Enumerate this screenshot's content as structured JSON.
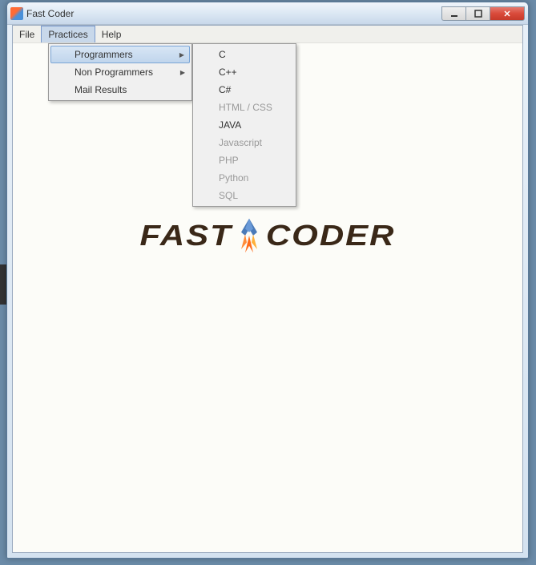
{
  "window": {
    "title": "Fast Coder"
  },
  "menubar": {
    "items": [
      {
        "label": "File"
      },
      {
        "label": "Practices"
      },
      {
        "label": "Help"
      }
    ]
  },
  "dropdown_practices": {
    "items": [
      {
        "label": "Programmers",
        "has_submenu": true,
        "highlighted": true
      },
      {
        "label": "Non Programmers",
        "has_submenu": true
      },
      {
        "label": "Mail Results",
        "has_submenu": false
      }
    ]
  },
  "dropdown_programmers": {
    "items": [
      {
        "label": "C",
        "enabled": true
      },
      {
        "label": "C++",
        "enabled": true
      },
      {
        "label": "C#",
        "enabled": true
      },
      {
        "label": "HTML / CSS",
        "enabled": false
      },
      {
        "label": "JAVA",
        "enabled": true
      },
      {
        "label": "Javascript",
        "enabled": false
      },
      {
        "label": "PHP",
        "enabled": false
      },
      {
        "label": "Python",
        "enabled": false
      },
      {
        "label": "SQL",
        "enabled": false
      }
    ]
  },
  "logo": {
    "text_left": "FAST",
    "text_right": "CODER"
  }
}
